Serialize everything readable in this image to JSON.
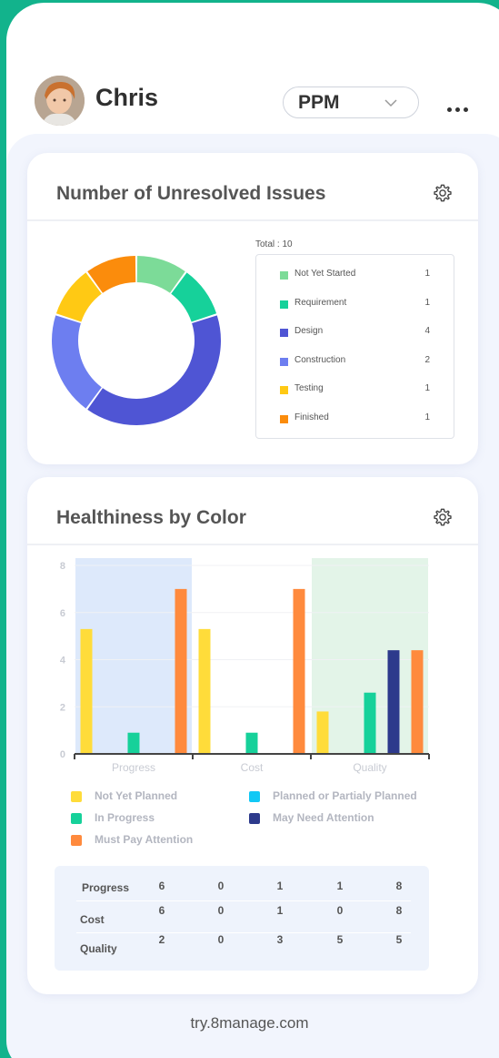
{
  "header": {
    "user_name": "Chris",
    "project_select": "PPM",
    "more_icon": "more-icon"
  },
  "issues_card": {
    "title": "Number of Unresolved Issues",
    "total_label": "Total : 10",
    "items": [
      {
        "label": "Not Yet Started",
        "value": "1",
        "color": "#7cdb98"
      },
      {
        "label": "Requirement",
        "value": "1",
        "color": "#16d19a"
      },
      {
        "label": "Design",
        "value": "4",
        "color": "#4f55d4"
      },
      {
        "label": "Construction",
        "value": "2",
        "color": "#6d7ef0"
      },
      {
        "label": "Testing",
        "value": "1",
        "color": "#ffc914"
      },
      {
        "label": "Finished",
        "value": "1",
        "color": "#fb8c0c"
      }
    ]
  },
  "health_card": {
    "title": "Healthiness by Color",
    "legend": [
      {
        "label": "Not Yet Planned",
        "color": "#ffdc3a"
      },
      {
        "label": "Planned or Partialy Planned",
        "color": "#12c8f5"
      },
      {
        "label": "In Progress",
        "color": "#16d19a"
      },
      {
        "label": "May Need Attention",
        "color": "#2d3a8c"
      },
      {
        "label": "Must Pay Attention",
        "color": "#ff8a3d"
      }
    ],
    "table": [
      {
        "name": "Progress",
        "values": [
          "6",
          "0",
          "1",
          "1",
          "8"
        ]
      },
      {
        "name": "Cost",
        "values": [
          "6",
          "0",
          "1",
          "0",
          "8"
        ]
      },
      {
        "name": "Quality",
        "values": [
          "2",
          "0",
          "3",
          "5",
          "5"
        ]
      }
    ]
  },
  "chart_data": [
    {
      "type": "pie",
      "title": "Number of Unresolved Issues",
      "categories": [
        "Not Yet Started",
        "Requirement",
        "Design",
        "Construction",
        "Testing",
        "Finished"
      ],
      "values": [
        1,
        1,
        4,
        2,
        1,
        1
      ],
      "total": 10
    },
    {
      "type": "bar",
      "title": "Healthiness by Color",
      "categories": [
        "Progress",
        "Cost",
        "Quality"
      ],
      "ylim": [
        0,
        8
      ],
      "yticks": [
        "0",
        "2",
        "4",
        "6",
        "8"
      ],
      "series": [
        {
          "name": "Not Yet Planned",
          "values": [
            5.3,
            5.3,
            1.8
          ]
        },
        {
          "name": "Planned or Partialy Planned",
          "values": [
            0,
            0,
            0
          ]
        },
        {
          "name": "In Progress",
          "values": [
            0.9,
            0.9,
            2.6
          ]
        },
        {
          "name": "May Need Attention",
          "values": [
            0,
            0,
            4.4
          ]
        },
        {
          "name": "Must Pay Attention",
          "values": [
            7.0,
            7.0,
            4.4
          ]
        }
      ],
      "category_backgrounds": [
        "#dde9fb",
        "#ffffff",
        "#e3f4e8"
      ]
    }
  ],
  "footer": {
    "text": "try.8manage.com"
  }
}
